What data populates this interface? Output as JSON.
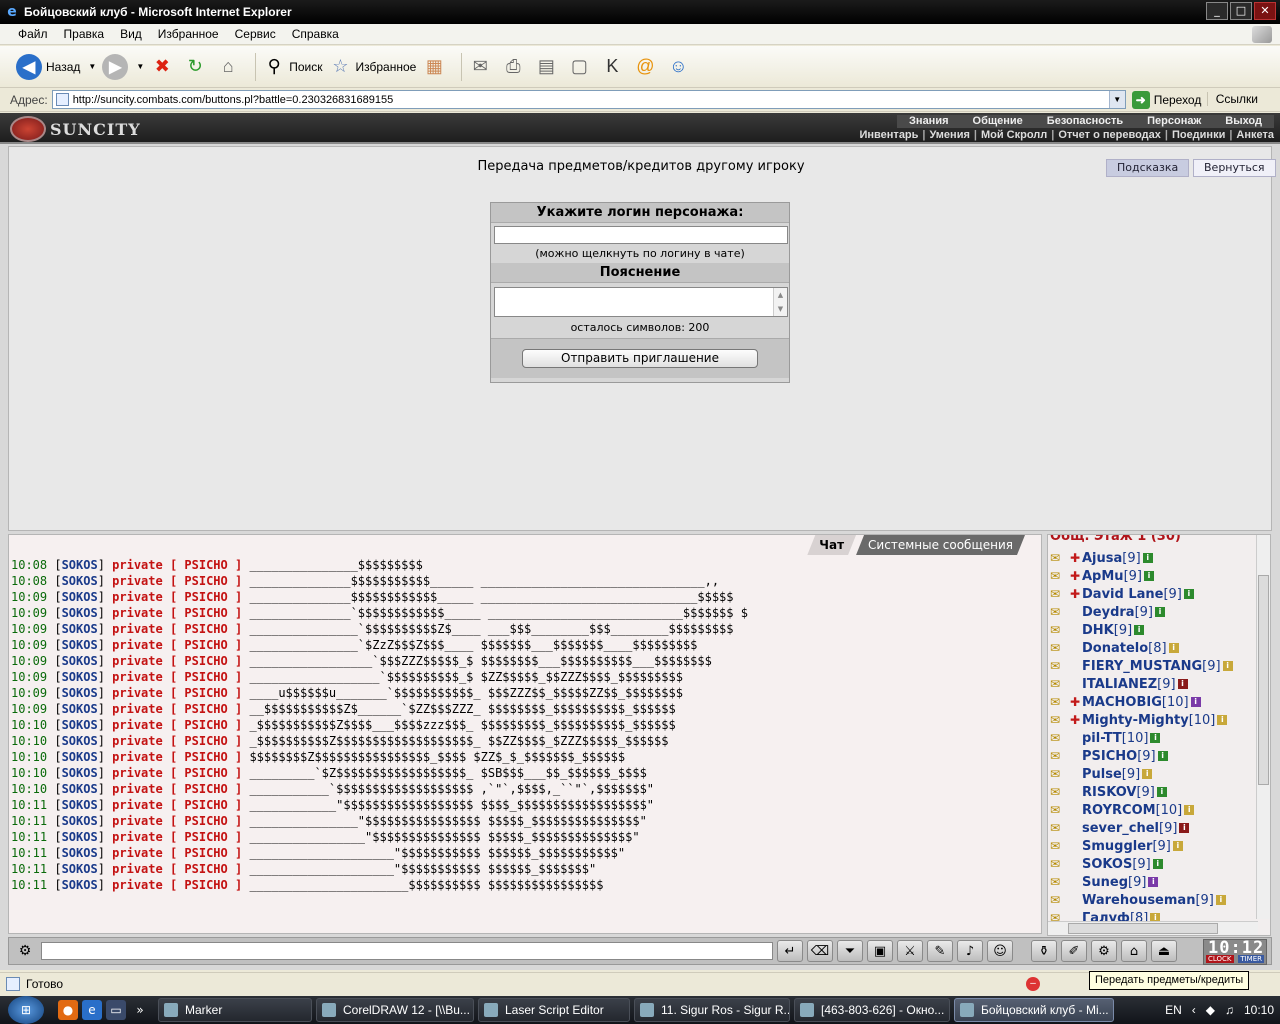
{
  "window": {
    "title": "Бойцовский клуб - Microsoft Internet Explorer"
  },
  "menu": [
    "Файл",
    "Правка",
    "Вид",
    "Избранное",
    "Сервис",
    "Справка"
  ],
  "toolbar": {
    "back": "Назад",
    "search": "Поиск",
    "favorites": "Избранное"
  },
  "address": {
    "label": "Адрес:",
    "url": "http://suncity.combats.com/buttons.pl?battle=0.230326831689155",
    "go": "Переход",
    "links": "Ссылки"
  },
  "site": {
    "logo": "SUNCITY",
    "nav_top": [
      "Знания",
      "Общение",
      "Безопасность",
      "Персонаж",
      "Выход"
    ],
    "nav_sub": [
      "Инвентарь",
      "Умения",
      "Мой Скролл",
      "Отчет о переводах",
      "Поединки",
      "Анкета"
    ]
  },
  "page": {
    "heading": "Передача предметов/кредитов другому игроку",
    "hint_button": "Подсказка",
    "back_button": "Вернуться",
    "login_label": "Укажите логин персонажа:",
    "login_value": "",
    "login_note": "(можно щелкнуть по логину в чате)",
    "explain_label": "Пояснение",
    "explain_value": "",
    "chars_left": "осталось символов: 200",
    "send_button": "Отправить приглашение"
  },
  "chat": {
    "tabs": [
      "Чат",
      "Системные сообщения"
    ],
    "messages": [
      {
        "time": "10:08",
        "nick": "SOKOS",
        "to": "private [ PSICHO ]",
        "text": "_______________$$$$$$$$$"
      },
      {
        "time": "10:08",
        "nick": "SOKOS",
        "to": "private [ PSICHO ]",
        "text": "______________$$$$$$$$$$$______ _______________________________,,"
      },
      {
        "time": "10:09",
        "nick": "SOKOS",
        "to": "private [ PSICHO ]",
        "text": "______________$$$$$$$$$$$$_____ ______________________________$$$$$"
      },
      {
        "time": "10:09",
        "nick": "SOKOS",
        "to": "private [ PSICHO ]",
        "text": "______________`$$$$$$$$$$$$_____ ___________________________$$$$$$$ $"
      },
      {
        "time": "10:09",
        "nick": "SOKOS",
        "to": "private [ PSICHO ]",
        "text": "_______________`$$$$$$$$$$Z$____ ___$$$________$$$________$$$$$$$$$"
      },
      {
        "time": "10:09",
        "nick": "SOKOS",
        "to": "private [ PSICHO ]",
        "text": "_______________`$ZzZ$$$Z$$$____ $$$$$$$___$$$$$$$____$$$$$$$$$"
      },
      {
        "time": "10:09",
        "nick": "SOKOS",
        "to": "private [ PSICHO ]",
        "text": "_________________`$$$ZZZ$$$$$_$ $$$$$$$$___$$$$$$$$$$___$$$$$$$$"
      },
      {
        "time": "10:09",
        "nick": "SOKOS",
        "to": "private [ PSICHO ]",
        "text": "__________________`$$$$$$$$$$_$ $ZZ$$$$$_$$ZZZ$$$$_$$$$$$$$$"
      },
      {
        "time": "10:09",
        "nick": "SOKOS",
        "to": "private [ PSICHO ]",
        "text": "____u$$$$$$u_______`$$$$$$$$$$$_ $$$ZZZ$$_$$$$$ZZ$$_$$$$$$$$"
      },
      {
        "time": "10:09",
        "nick": "SOKOS",
        "to": "private [ PSICHO ]",
        "text": "__$$$$$$$$$$$Z$______`$ZZ$$$ZZZ_ $$$$$$$$_$$$$$$$$$$_$$$$$$"
      },
      {
        "time": "10:10",
        "nick": "SOKOS",
        "to": "private [ PSICHO ]",
        "text": "_$$$$$$$$$$$Z$$$$___$$$$zzz$$$_ $$$$$$$$$_$$$$$$$$$$_$$$$$$"
      },
      {
        "time": "10:10",
        "nick": "SOKOS",
        "to": "private [ PSICHO ]",
        "text": "_$$$$$$$$$$Z$$$$$$$$$$$$$$$$$$$_ $$ZZ$$$$_$ZZZ$$$$$_$$$$$$"
      },
      {
        "time": "10:10",
        "nick": "SOKOS",
        "to": "private [ PSICHO ]",
        "text": "$$$$$$$$Z$$$$$$$$$$$$$$$$_$$$$ $ZZ$_$_$$$$$$$_$$$$$$"
      },
      {
        "time": "10:10",
        "nick": "SOKOS",
        "to": "private [ PSICHO ]",
        "text": "_________`$Z$$$$$$$$$$$$$$$$$$_ $SB$$$___$$_$$$$$$_$$$$"
      },
      {
        "time": "10:10",
        "nick": "SOKOS",
        "to": "private [ PSICHO ]",
        "text": "___________`$$$$$$$$$$$$$$$$$$$ ,`\"`,$$$$,_``\"`,$$$$$$$\""
      },
      {
        "time": "10:11",
        "nick": "SOKOS",
        "to": "private [ PSICHO ]",
        "text": "____________\"$$$$$$$$$$$$$$$$$$ $$$$_$$$$$$$$$$$$$$$$$$\""
      },
      {
        "time": "10:11",
        "nick": "SOKOS",
        "to": "private [ PSICHO ]",
        "text": "_______________\"$$$$$$$$$$$$$$$$ $$$$$_$$$$$$$$$$$$$$$\""
      },
      {
        "time": "10:11",
        "nick": "SOKOS",
        "to": "private [ PSICHO ]",
        "text": "________________\"$$$$$$$$$$$$$$$ $$$$$_$$$$$$$$$$$$$$\""
      },
      {
        "time": "10:11",
        "nick": "SOKOS",
        "to": "private [ PSICHO ]",
        "text": "____________________\"$$$$$$$$$$$ $$$$$$_$$$$$$$$$$$\""
      },
      {
        "time": "10:11",
        "nick": "SOKOS",
        "to": "private [ PSICHO ]",
        "text": "____________________\"$$$$$$$$$$$ $$$$$$_$$$$$$$\""
      },
      {
        "time": "10:11",
        "nick": "SOKOS",
        "to": "private [ PSICHO ]",
        "text": "______________________$$$$$$$$$$ $$$$$$$$$$$$$$$$"
      }
    ]
  },
  "online": {
    "room": "Общ. Этаж 1 (30)",
    "users": [
      {
        "nick": "Ajusa",
        "lvl": "[9]",
        "info": "g",
        "mark": true
      },
      {
        "nick": "ApMu",
        "lvl": "[9]",
        "info": "g",
        "mark": true
      },
      {
        "nick": "David Lane",
        "lvl": "[9]",
        "info": "g",
        "mark": true
      },
      {
        "nick": "Deydra",
        "lvl": "[9]",
        "info": "g",
        "mark": false
      },
      {
        "nick": "DHK",
        "lvl": "[9]",
        "info": "g",
        "mark": false
      },
      {
        "nick": "Donatelo",
        "lvl": "[8]",
        "info": "y",
        "mark": false
      },
      {
        "nick": "FIERY_MUSTANG",
        "lvl": "[9]",
        "info": "y",
        "mark": false
      },
      {
        "nick": "ITALIANEZ",
        "lvl": "[9]",
        "info": "r",
        "mark": false
      },
      {
        "nick": "MACHOBIG",
        "lvl": "[10]",
        "info": "p",
        "mark": true
      },
      {
        "nick": "Mighty-Mighty",
        "lvl": "[10]",
        "info": "y",
        "mark": true
      },
      {
        "nick": "pil-TT",
        "lvl": "[10]",
        "info": "g",
        "mark": false
      },
      {
        "nick": "PSICHO",
        "lvl": "[9]",
        "info": "g",
        "mark": false
      },
      {
        "nick": "Pulse",
        "lvl": "[9]",
        "info": "y",
        "mark": false
      },
      {
        "nick": "RISKOV",
        "lvl": "[9]",
        "info": "g",
        "mark": false
      },
      {
        "nick": "ROYRCOM",
        "lvl": "[10]",
        "info": "y",
        "mark": false
      },
      {
        "nick": "sever_chel",
        "lvl": "[9]",
        "info": "r",
        "mark": false
      },
      {
        "nick": "Smuggler",
        "lvl": "[9]",
        "info": "y",
        "mark": false
      },
      {
        "nick": "SOKOS",
        "lvl": "[9]",
        "info": "g",
        "mark": false
      },
      {
        "nick": "Suneg",
        "lvl": "[9]",
        "info": "p",
        "mark": false
      },
      {
        "nick": "Warehouseman",
        "lvl": "[9]",
        "info": "y",
        "mark": false
      },
      {
        "nick": "Галуф",
        "lvl": "[8]",
        "info": "y",
        "mark": false
      }
    ]
  },
  "clock": {
    "time": "10:12",
    "label_a": "CLOCK",
    "label_b": "TIMER"
  },
  "status": {
    "text": "Готово",
    "tooltip": "Передать предметы/кредиты"
  },
  "taskbar": {
    "tasks": [
      "Marker",
      "CorelDRAW 12 - [\\\\Bu...",
      "Laser Script Editor",
      "11. Sigur Ros - Sigur R...",
      "[463-803-626] - Окно...",
      "Бойцовский клуб - Mi..."
    ],
    "lang": "EN",
    "time": "10:10"
  }
}
